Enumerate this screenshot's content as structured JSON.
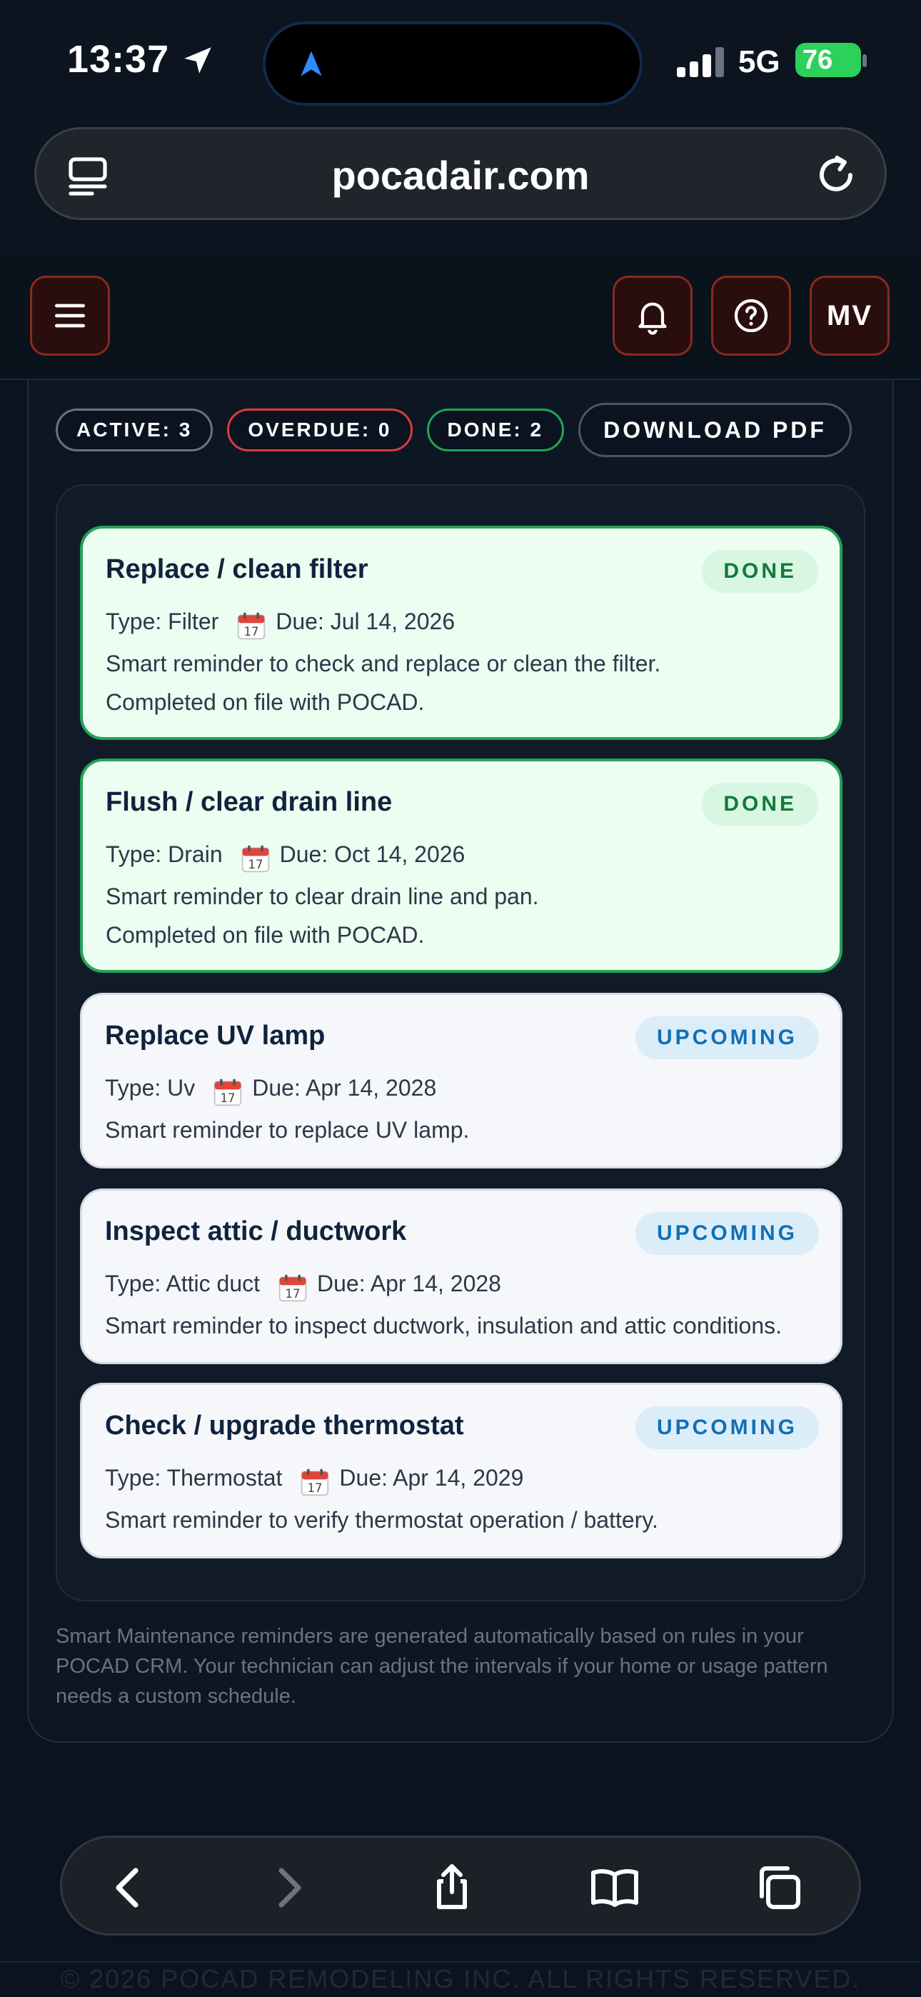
{
  "status_bar": {
    "time": "13:37",
    "network": "5G",
    "battery": "76"
  },
  "browser": {
    "url": "pocadair.com"
  },
  "header": {
    "avatar_initials": "MV"
  },
  "summary": {
    "active_label": "ACTIVE: 3",
    "overdue_label": "OVERDUE: 0",
    "done_label": "DONE: 2",
    "download_label": "DOWNLOAD PDF"
  },
  "reminders": [
    {
      "title": "Replace / clean filter",
      "status": "DONE",
      "type": "Type: Filter",
      "due": "Due: Jul 14, 2026",
      "description": "Smart reminder to check and replace or clean the filter.",
      "note": "Completed on file with POCAD."
    },
    {
      "title": "Flush / clear drain line",
      "status": "DONE",
      "type": "Type: Drain",
      "due": "Due: Oct 14, 2026",
      "description": "Smart reminder to clear drain line and pan.",
      "note": "Completed on file with POCAD."
    },
    {
      "title": "Replace UV lamp",
      "status": "UPCOMING",
      "type": "Type: Uv",
      "due": "Due: Apr 14, 2028",
      "description": "Smart reminder to replace UV lamp."
    },
    {
      "title": "Inspect attic / ductwork",
      "status": "UPCOMING",
      "type": "Type: Attic duct",
      "due": "Due: Apr 14, 2028",
      "description": "Smart reminder to inspect ductwork, insulation and attic conditions."
    },
    {
      "title": "Check / upgrade thermostat",
      "status": "UPCOMING",
      "type": "Type: Thermostat",
      "due": "Due: Apr 14, 2029",
      "description": "Smart reminder to verify thermostat operation / battery."
    }
  ],
  "footer_note": "Smart Maintenance reminders are generated automatically based on rules in your POCAD CRM. Your technician can adjust the intervals if your home or usage pattern needs a custom schedule.",
  "copyright": "© 2026 POCAD REMODELING INC. ALL RIGHTS RESERVED."
}
